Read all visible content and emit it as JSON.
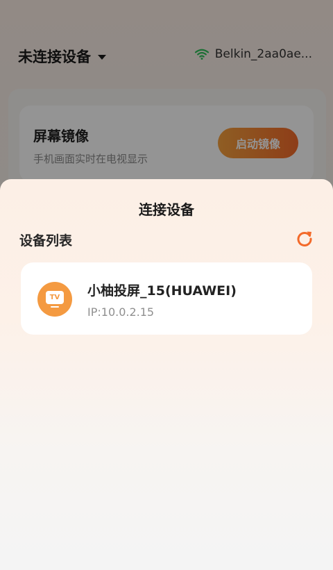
{
  "background": {
    "device_selector_label": "未连接设备",
    "wifi_name": "Belkin_2aa0ae...",
    "mirror_card": {
      "title": "屏幕镜像",
      "description": "手机画面实时在电视显示",
      "button_label": "启动镜像"
    }
  },
  "sheet": {
    "title": "连接设备",
    "list_header": "设备列表",
    "devices": [
      {
        "name": "小柚投屏_15(HUAWEI)",
        "ip": "IP:10.0.2.15",
        "icon_text": "TV"
      }
    ]
  },
  "colors": {
    "accent_orange": "#f36a2a",
    "icon_orange": "#f49a41",
    "wifi_green": "#2fbf5a"
  },
  "icons": [
    "caret-down-icon",
    "wifi-icon",
    "refresh-icon",
    "tv-icon"
  ]
}
